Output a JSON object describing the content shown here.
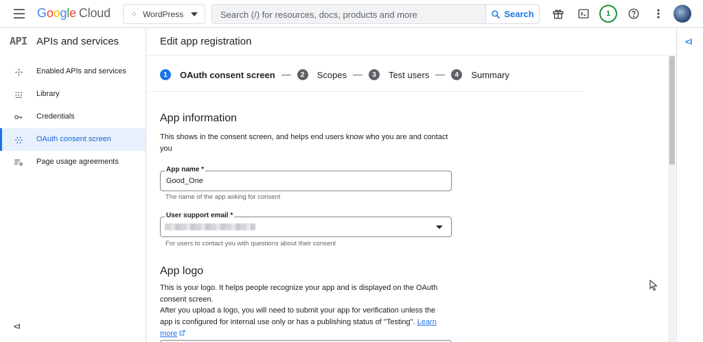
{
  "topbar": {
    "logo": {
      "g1": "G",
      "g2": "o",
      "g3": "o",
      "g4": "g",
      "g5": "l",
      "g6": "e",
      "cloud": "Cloud"
    },
    "project": "WordPress",
    "search_placeholder": "Search (/) for resources, docs, products and more",
    "search_button": "Search",
    "notification_count": "1"
  },
  "sidebar": {
    "api_badge": "API",
    "title": "APIs and services",
    "items": [
      {
        "label": "Enabled APIs and services",
        "icon": "diamond-arrows-icon"
      },
      {
        "label": "Library",
        "icon": "library-grid-icon"
      },
      {
        "label": "Credentials",
        "icon": "key-icon"
      },
      {
        "label": "OAuth consent screen",
        "icon": "dots-grid-icon",
        "active": true
      },
      {
        "label": "Page usage agreements",
        "icon": "settings-list-icon"
      }
    ],
    "collapse": "<I"
  },
  "main": {
    "page_title": "Edit app registration",
    "steps": [
      {
        "num": "1",
        "label": "OAuth consent screen"
      },
      {
        "num": "2",
        "label": "Scopes"
      },
      {
        "num": "3",
        "label": "Test users"
      },
      {
        "num": "4",
        "label": "Summary"
      }
    ],
    "app_info": {
      "heading": "App information",
      "desc": "This shows in the consent screen, and helps end users know who you are and contact you",
      "app_name_label": "App name *",
      "app_name_value": "Good_One",
      "app_name_hint": "The name of the app asking for consent",
      "email_label": "User support email *",
      "email_hint": "For users to contact you with questions about their consent"
    },
    "app_logo": {
      "heading": "App logo",
      "p1": "This is your logo. It helps people recognize your app and is displayed on the OAuth consent screen.",
      "p2": "After you upload a logo, you will need to submit your app for verification unless the app is configured for internal use only or has a publishing status of \"Testing\".",
      "learn_more": "Learn more"
    }
  },
  "rightrail": {
    "toggle": "<I"
  },
  "colors": {
    "accent": "#1a73e8",
    "active_bg": "#e8f0fe",
    "green": "#1e8e3e"
  }
}
